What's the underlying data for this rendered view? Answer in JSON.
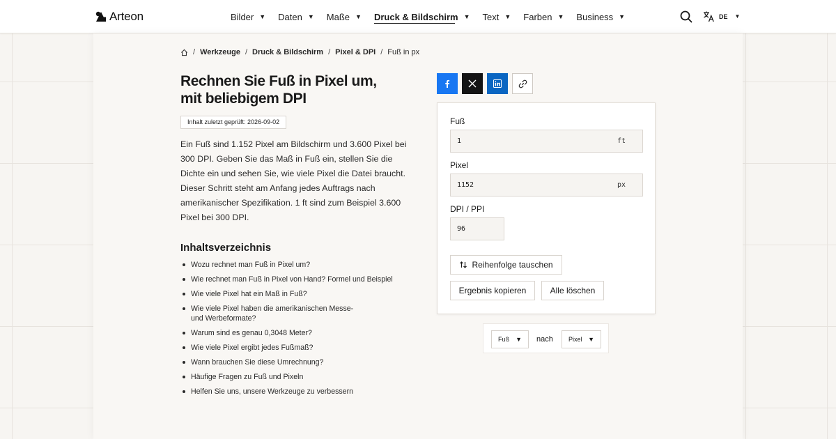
{
  "brand": {
    "name": "Arteon"
  },
  "nav": {
    "items": [
      {
        "label": "Bilder"
      },
      {
        "label": "Daten"
      },
      {
        "label": "Maße"
      },
      {
        "label": "Druck & Bildschirm",
        "active": true
      },
      {
        "label": "Text"
      },
      {
        "label": "Farben"
      },
      {
        "label": "Business"
      }
    ],
    "caret": "▼"
  },
  "language": {
    "code": "DE",
    "caret": "▼"
  },
  "breadcrumb": {
    "sep": "/",
    "items": [
      "Werkzeuge",
      "Druck & Bildschirm",
      "Pixel & DPI"
    ],
    "current": "Fuß in px"
  },
  "page": {
    "title": "Rechnen Sie Fuß in Pixel um, mit beliebigem DPI",
    "reviewed": "Inhalt zuletzt geprüft: 2026-09-02",
    "intro": "Ein Fuß sind 1.152 Pixel am Bildschirm und 3.600 Pixel bei 300 DPI. Geben Sie das Maß in Fuß ein, stellen Sie die Dichte ein und sehen Sie, wie viele Pixel die Datei braucht. Dieser Schritt steht am Anfang jedes Auftrags nach amerikanischer Spezifikation. 1 ft sind zum Beispiel 3.600 Pixel bei 300 DPI."
  },
  "toc": {
    "title": "Inhaltsverzeichnis",
    "items": [
      "Wozu rechnet man Fuß in Pixel um?",
      "Wie rechnet man Fuß in Pixel von Hand? Formel und Beispiel",
      "Wie viele Pixel hat ein Maß in Fuß?",
      "Wie viele Pixel haben die amerikanischen Messe- und Werbeformate?",
      "Warum sind es genau 0,3048 Meter?",
      "Wie viele Pixel ergibt jedes Fußmaß?",
      "Wann brauchen Sie diese Umrechnung?",
      "Häufige Fragen zu Fuß und Pixeln",
      "Helfen Sie uns, unsere Werkzeuge zu verbessern"
    ]
  },
  "converter": {
    "feet": {
      "label": "Fuß",
      "value": "1",
      "unit": "ft"
    },
    "pixels": {
      "label": "Pixel",
      "value": "1152",
      "unit": "px"
    },
    "dpi": {
      "label": "DPI / PPI",
      "value": "96"
    },
    "swap_label": "Reihenfolge tauschen",
    "copy_label": "Ergebnis kopieren",
    "clear_label": "Alle löschen"
  },
  "units": {
    "from": "Fuß",
    "connector": "nach",
    "to": "Pixel",
    "caret": "▼"
  },
  "colors": {
    "facebook": "#1877f2",
    "x": "#141414",
    "linkedin": "#0a66c2",
    "background": "#f7f5f2"
  }
}
